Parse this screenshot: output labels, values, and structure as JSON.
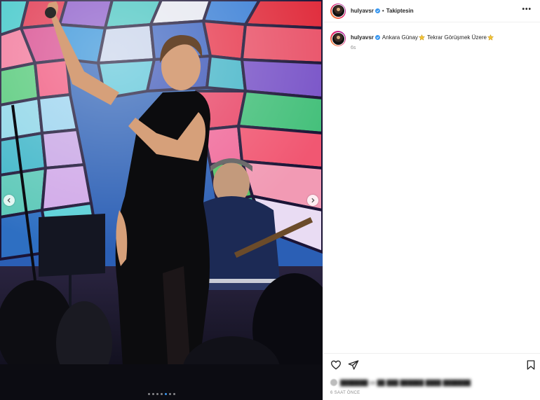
{
  "post": {
    "username": "hulyavsr",
    "verified": true,
    "separator": "•",
    "follow_label": "Takiptesin",
    "more_label": "•••",
    "caption": {
      "username": "hulyavsr",
      "text_part1": "Ankara Günay",
      "text_part2": "Tekrar Görüşmek Üzere",
      "time": "6s"
    },
    "likes_text": "███████ ve ██ ███ ██████ ████ ███████",
    "timestamp": "6 SAAT ÖNCE",
    "carousel": {
      "slide_count": 7,
      "active_index": 4
    }
  },
  "icons": {
    "like": "heart-icon",
    "share": "paper-plane-icon",
    "save": "bookmark-icon",
    "prev": "chevron-left-icon",
    "next": "chevron-right-icon",
    "verified": "verified-badge-icon",
    "star": "star-emoji-icon"
  },
  "colors": {
    "verified": "#3897f0",
    "star": "#f4c430",
    "secondary_text": "#8e8e8e",
    "active_dot": "#3897f0"
  }
}
